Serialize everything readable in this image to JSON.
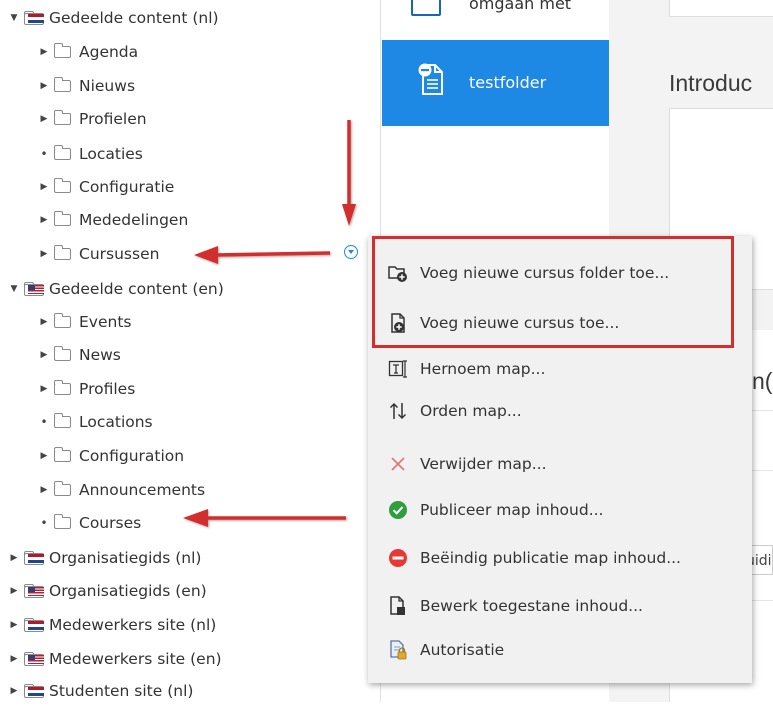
{
  "tree": {
    "items": [
      {
        "label": "Gedeelde content (nl)",
        "flag": "nl",
        "level": 0,
        "state": "expanded"
      },
      {
        "label": "Agenda",
        "level": 1,
        "state": "collapsed"
      },
      {
        "label": "Nieuws",
        "level": 1,
        "state": "collapsed"
      },
      {
        "label": "Profielen",
        "level": 1,
        "state": "collapsed"
      },
      {
        "label": "Locaties",
        "level": 1,
        "state": "leaf"
      },
      {
        "label": "Configuratie",
        "level": 1,
        "state": "collapsed"
      },
      {
        "label": "Mededelingen",
        "level": 1,
        "state": "collapsed"
      },
      {
        "label": "Cursussen",
        "level": 1,
        "state": "collapsed"
      },
      {
        "label": "Gedeelde content (en)",
        "flag": "en",
        "level": 0,
        "state": "expanded"
      },
      {
        "label": "Events",
        "level": 1,
        "state": "collapsed"
      },
      {
        "label": "News",
        "level": 1,
        "state": "collapsed"
      },
      {
        "label": "Profiles",
        "level": 1,
        "state": "collapsed"
      },
      {
        "label": "Locations",
        "level": 1,
        "state": "leaf"
      },
      {
        "label": "Configuration",
        "level": 1,
        "state": "collapsed"
      },
      {
        "label": "Announcements",
        "level": 1,
        "state": "collapsed"
      },
      {
        "label": "Courses",
        "level": 1,
        "state": "leaf"
      },
      {
        "label": "Organisatiegids (nl)",
        "flag": "nl",
        "level": 0,
        "state": "collapsed"
      },
      {
        "label": "Organisatiegids (en)",
        "flag": "en",
        "level": 0,
        "state": "collapsed"
      },
      {
        "label": "Medewerkers site (nl)",
        "flag": "nl",
        "level": 0,
        "state": "collapsed"
      },
      {
        "label": "Medewerkers site (en)",
        "flag": "en",
        "level": 0,
        "state": "collapsed"
      },
      {
        "label": "Studenten site (nl)",
        "flag": "nl",
        "level": 0,
        "state": "collapsed"
      }
    ]
  },
  "middle": {
    "top_item_label": "omgaan met",
    "selected_item_label": "testfolder"
  },
  "right": {
    "intro_heading": "Introduc",
    "section_heading": "n(s",
    "field_fragment": "uidi"
  },
  "context_menu": {
    "items": [
      {
        "label": "Voeg nieuwe cursus folder toe...",
        "icon": "folder-add-icon"
      },
      {
        "label": "Voeg nieuwe cursus toe...",
        "icon": "document-add-icon"
      },
      {
        "label": "Hernoem map...",
        "icon": "rename-icon"
      },
      {
        "label": "Orden map...",
        "icon": "sort-icon"
      },
      {
        "label": "Verwijder map...",
        "icon": "delete-icon"
      },
      {
        "label": "Publiceer map inhoud...",
        "icon": "publish-icon"
      },
      {
        "label": "Beëindig publicatie map inhoud...",
        "icon": "unpublish-icon"
      },
      {
        "label": "Bewerk toegestane inhoud...",
        "icon": "edit-allowed-content-icon"
      },
      {
        "label": "Autorisatie",
        "icon": "authorization-icon"
      }
    ]
  },
  "colors": {
    "accent": "#1e88e5",
    "annotation": "#d32f2f",
    "publish": "#2e9e3e",
    "unpublish": "#e53935",
    "delete": "#e57373"
  }
}
